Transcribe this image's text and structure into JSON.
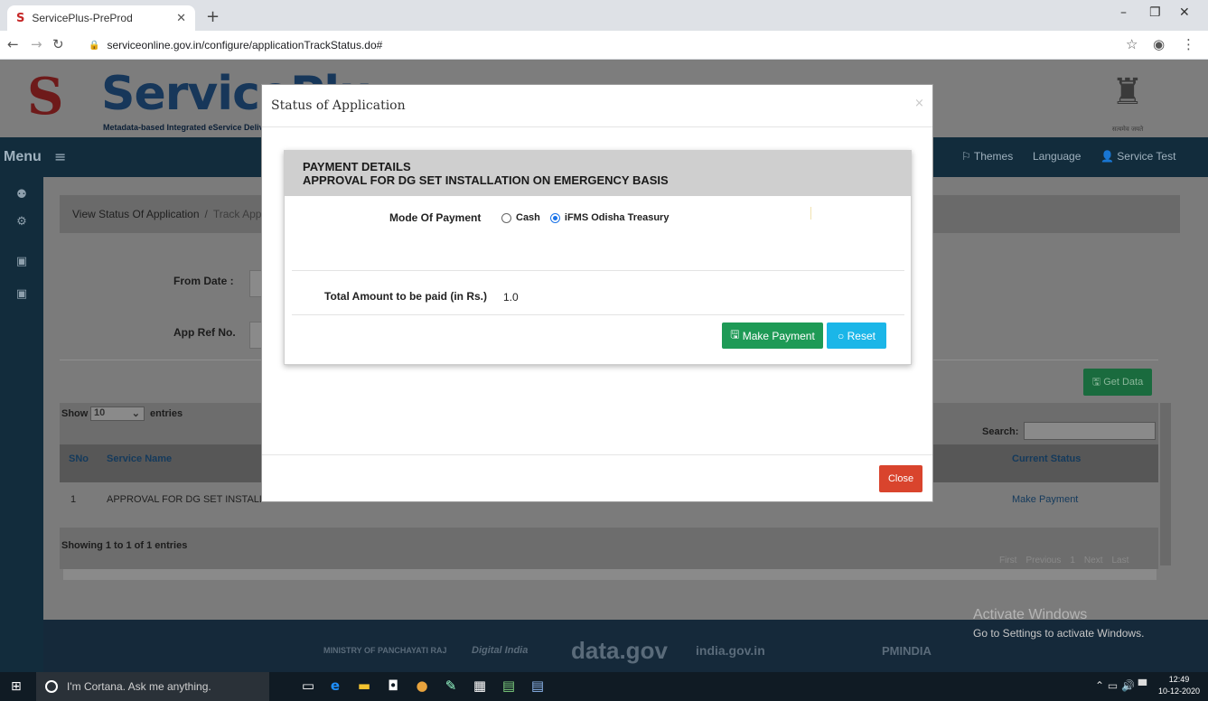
{
  "browser": {
    "tab_title": "ServicePlus-PreProd",
    "tab_favicon": "SP",
    "url": "serviceonline.gov.in/configure/applicationTrackStatus.do#"
  },
  "header": {
    "logo_text": "ServicePlu",
    "logo_tagline": "Metadata-based Integrated eService Deliver",
    "emblem_caption": "सत्यमेव जयते"
  },
  "menubar": {
    "menu_label": "Menu",
    "themes_label": "Themes",
    "language_label": "Language",
    "user_name": "Service Test"
  },
  "breadcrumb": {
    "item1": "View Status Of Application",
    "item2": "Track Appl"
  },
  "filters": {
    "from_date_label": "From Date :",
    "app_ref_label": "App Ref No.",
    "get_data_label": "Get Data"
  },
  "table": {
    "show_label": "Show",
    "show_value": "10",
    "entries_label": "entries",
    "search_label": "Search:",
    "headers": [
      "SNo",
      "Service Name",
      "Current Status"
    ],
    "rows": [
      {
        "sno": "1",
        "service": "APPROVAL FOR DG SET INSTALLAT",
        "status": "Make Payment"
      }
    ],
    "info": "Showing 1 to 1 of 1 entries",
    "pagination": [
      "First",
      "Previous",
      "1",
      "Next",
      "Last"
    ]
  },
  "modal": {
    "title": "Status of Application",
    "close_x": "×",
    "card_heading1": "PAYMENT DETAILS",
    "card_heading2": "APPROVAL FOR DG SET INSTALLATION ON EMERGENCY BASIS",
    "mode_label": "Mode Of Payment",
    "options": [
      "Cash",
      "iFMS Odisha Treasury"
    ],
    "selected_option": "iFMS Odisha Treasury",
    "amount_label": "Total Amount to be paid (in Rs.)",
    "amount_value": "1.0",
    "make_payment_label": "Make Payment",
    "reset_label": "Reset",
    "close_label": "Close"
  },
  "footer": {
    "logos": [
      "MINISTRY OF PANCHAYATI RAJ",
      "Digital India",
      "data.gov",
      "india.gov.in",
      "PMINDIA"
    ]
  },
  "watermark": {
    "line1": "Activate Windows",
    "line2": "Go to Settings to activate Windows."
  },
  "taskbar": {
    "search_placeholder": "I'm Cortana. Ask me anything.",
    "time": "12:49",
    "date": "10-12-2020"
  },
  "colors": {
    "accent_green": "#1e9a56",
    "accent_cyan": "#1bb6e8",
    "close_red": "#d9442d",
    "nav_dark": "#122c3c"
  }
}
